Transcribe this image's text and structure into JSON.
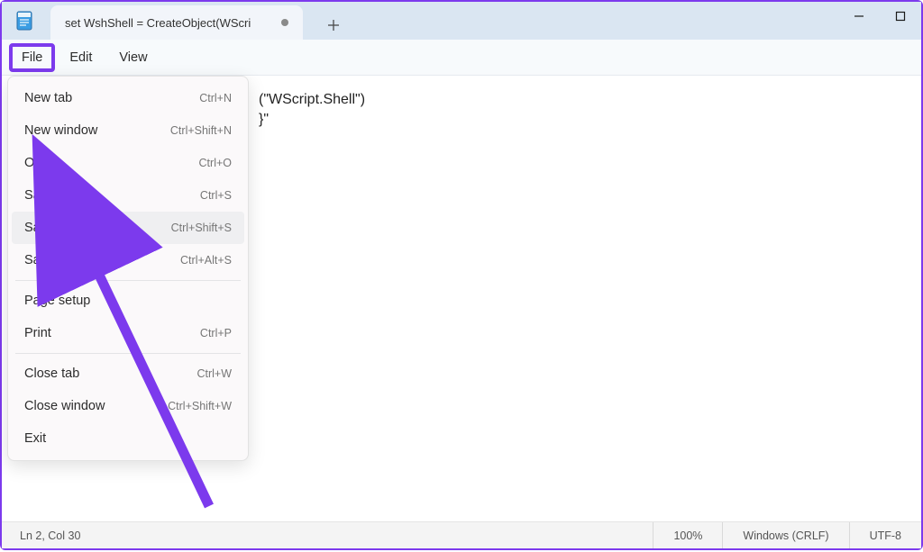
{
  "tab": {
    "title": "set WshShell = CreateObject(WScri"
  },
  "menubar": {
    "file": "File",
    "edit": "Edit",
    "view": "View"
  },
  "editor": {
    "line1_tail": "(\"WScript.Shell\")",
    "line2_tail": "}\""
  },
  "file_menu": {
    "items": [
      {
        "label": "New tab",
        "shortcut": "Ctrl+N",
        "sep": false
      },
      {
        "label": "New window",
        "shortcut": "Ctrl+Shift+N",
        "sep": false
      },
      {
        "label": "Open",
        "shortcut": "Ctrl+O",
        "sep": false
      },
      {
        "label": "Save",
        "shortcut": "Ctrl+S",
        "sep": false
      },
      {
        "label": "Save as",
        "shortcut": "Ctrl+Shift+S",
        "sep": false
      },
      {
        "label": "Save all",
        "shortcut": "Ctrl+Alt+S",
        "sep": true
      },
      {
        "label": "Page setup",
        "shortcut": "",
        "sep": false
      },
      {
        "label": "Print",
        "shortcut": "Ctrl+P",
        "sep": true
      },
      {
        "label": "Close tab",
        "shortcut": "Ctrl+W",
        "sep": false
      },
      {
        "label": "Close window",
        "shortcut": "Ctrl+Shift+W",
        "sep": false
      },
      {
        "label": "Exit",
        "shortcut": "",
        "sep": false
      }
    ],
    "hovered_index": 4
  },
  "statusbar": {
    "position": "Ln 2, Col 30",
    "zoom": "100%",
    "line_ending": "Windows (CRLF)",
    "encoding": "UTF-8"
  }
}
